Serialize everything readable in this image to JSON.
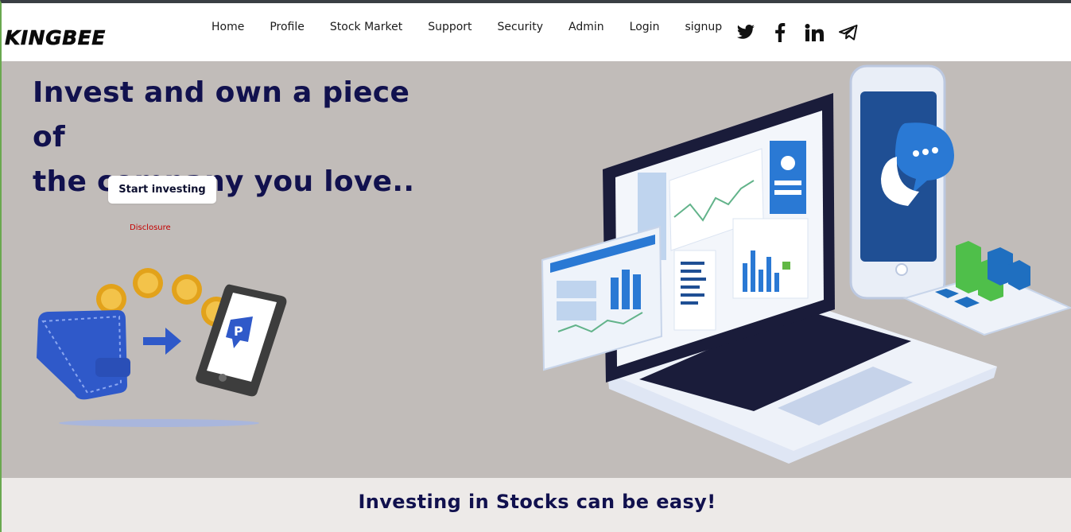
{
  "brand": {
    "name": "KINGBEE"
  },
  "nav": {
    "links": [
      "Home",
      "Profile",
      "Stock Market",
      "Support",
      "Security",
      "Admin",
      "Login",
      "signup"
    ]
  },
  "social": {
    "icons": [
      "twitter-icon",
      "facebook-icon",
      "linkedin-icon",
      "telegram-icon"
    ]
  },
  "hero": {
    "title_line1": "Invest and own a piece of",
    "title_line2": "the company you love..",
    "cta_label": "Start investing",
    "disclosure": "Disclosure"
  },
  "section": {
    "title": "Investing in Stocks can be easy!"
  },
  "colors": {
    "hero_bg": "#c1bcb9",
    "title": "#11114e",
    "disclosure": "#c40000",
    "accent_blue": "#2f59c9"
  }
}
